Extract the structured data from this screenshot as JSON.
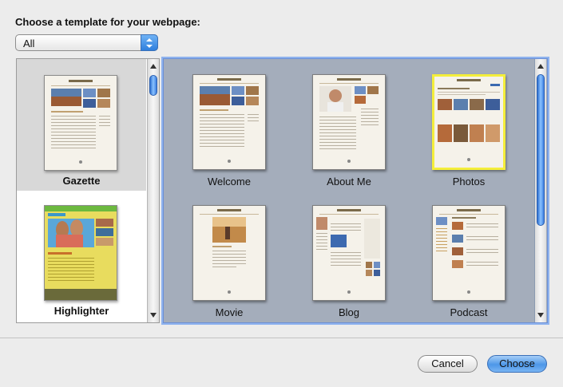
{
  "dialog": {
    "heading": "Choose a template for your webpage:"
  },
  "category_popup": {
    "selected": "All"
  },
  "themes": [
    {
      "label": "Gazette"
    },
    {
      "label": "Highlighter"
    }
  ],
  "templates": [
    {
      "label": "Welcome",
      "selected": false
    },
    {
      "label": "About Me",
      "selected": false
    },
    {
      "label": "Photos",
      "selected": true
    },
    {
      "label": "Movie",
      "selected": false
    },
    {
      "label": "Blog",
      "selected": false
    },
    {
      "label": "Podcast",
      "selected": false
    }
  ],
  "buttons": {
    "cancel": "Cancel",
    "choose": "Choose"
  },
  "colors": {
    "selection_border": "#f4ee3b",
    "accent": "#4d97e8",
    "template_pane_bg": "#a4adbb"
  }
}
